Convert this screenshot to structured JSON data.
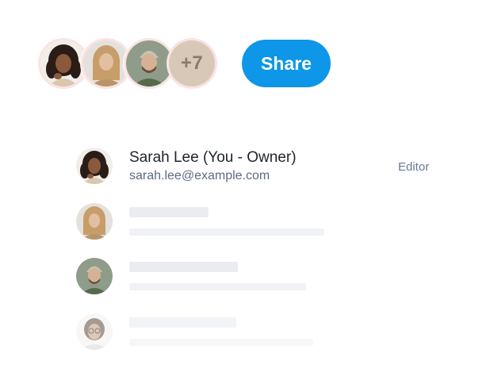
{
  "avatar_stack": {
    "more_count": "+7"
  },
  "share_button": {
    "label": "Share",
    "color": "#0e96e8"
  },
  "members": [
    {
      "name": "Sarah Lee (You - Owner)",
      "email": "sarah.lee@example.com",
      "role": "Editor"
    }
  ],
  "skeleton_rows": 3
}
